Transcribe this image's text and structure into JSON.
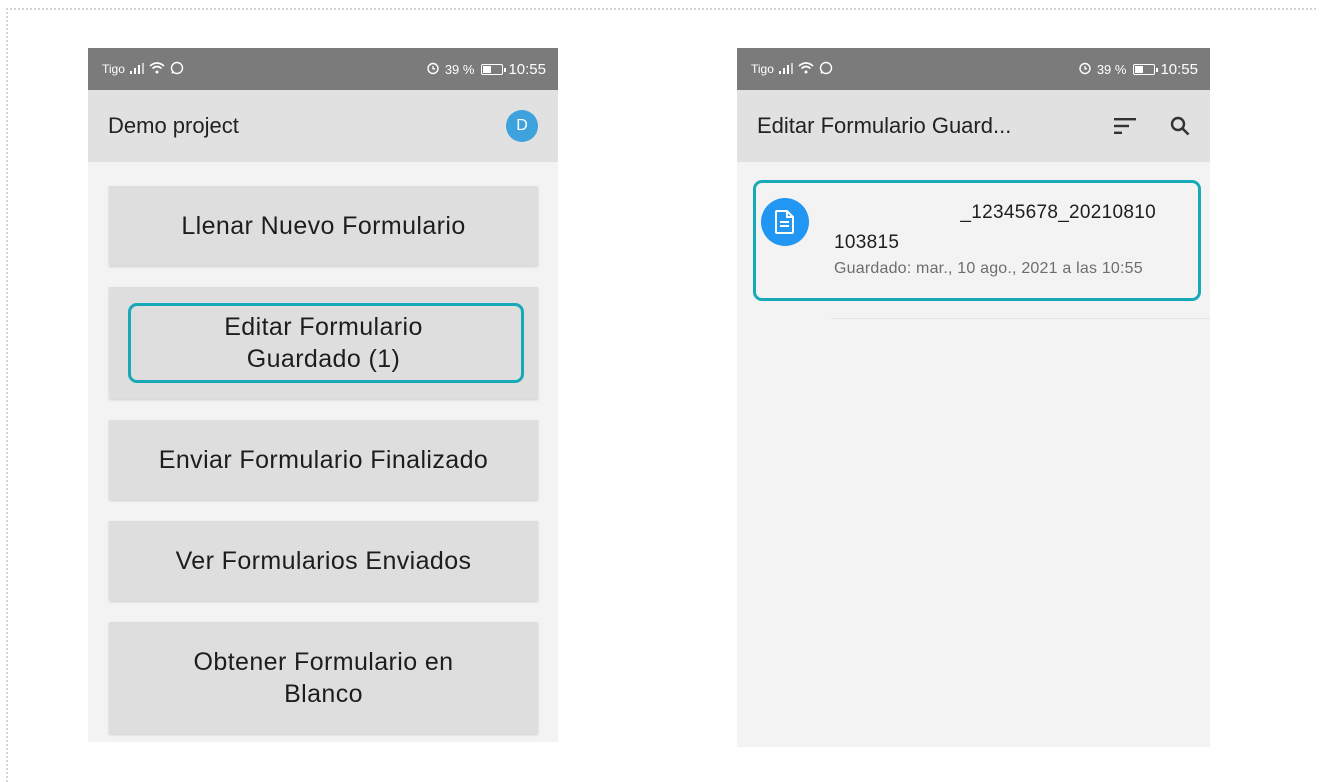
{
  "left_screen": {
    "status_bar": {
      "carrier": "Tigo",
      "battery": "39 %",
      "time": "10:55"
    },
    "app_bar": {
      "title": "Demo project",
      "avatar_initial": "D"
    },
    "menu_items": [
      {
        "label": "Llenar Nuevo Formulario"
      },
      {
        "label": "Editar Formulario Guardado (1)"
      },
      {
        "label": "Enviar Formulario Finalizado"
      },
      {
        "label": "Ver Formularios Enviados"
      },
      {
        "label": "Obtener Formulario en Blanco"
      }
    ],
    "highlighted_item": "Editar Formulario Guardado (1)"
  },
  "right_screen": {
    "status_bar": {
      "carrier": "Tigo",
      "battery": "39 %",
      "time": "10:55"
    },
    "app_bar": {
      "title": "Editar Formulario Guard...",
      "sort_icon": "sort-icon",
      "search_icon": "search-icon"
    },
    "saved_forms": [
      {
        "name_line1": "_12345678_20210810",
        "name_line2": "103815",
        "saved_text": "Guardado: mar., 10 ago., 2021 a las 10:55"
      }
    ]
  },
  "colors": {
    "highlight": "#17a9b7",
    "avatar": "#3ea2dd",
    "doc_icon": "#2196f3",
    "status_bar": "#7b7b7b",
    "app_bar": "#e1e1e1"
  }
}
